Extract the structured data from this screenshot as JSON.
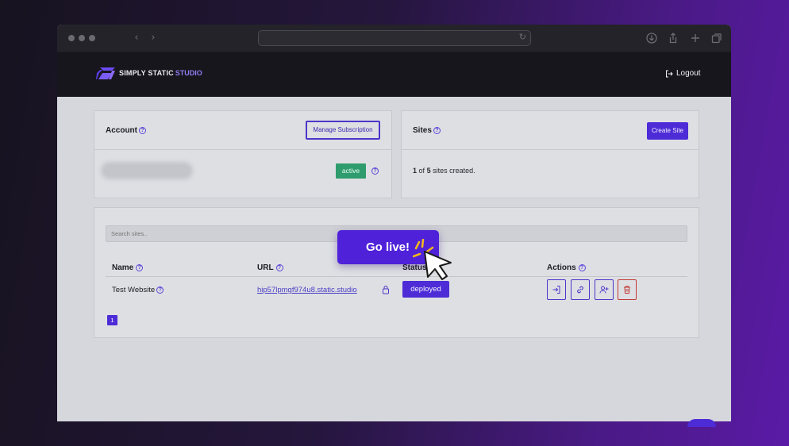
{
  "browser": {
    "url": "",
    "nav": {
      "back_icon": "chevron-left-icon",
      "forward_icon": "chevron-right-icon",
      "reload_icon": "reload-icon"
    },
    "toolbar_icons": [
      "download-icon",
      "share-icon",
      "new-tab-icon",
      "tabs-overview-icon"
    ]
  },
  "app": {
    "brand_main": "SIMPLY STATIC",
    "brand_accent": "STUDIO",
    "logout_label": "Logout"
  },
  "account": {
    "title": "Account",
    "manage_label": "Manage Subscription",
    "status": "active"
  },
  "sites_card": {
    "title": "Sites",
    "create_label": "Create Site",
    "count_used": "1",
    "count_of": "of",
    "count_total": "5",
    "count_suffix": "sites created."
  },
  "table": {
    "search_placeholder": "Search sites..",
    "headers": {
      "name": "Name",
      "url": "URL",
      "status": "Status",
      "actions": "Actions"
    },
    "rows": [
      {
        "name": "Test Website",
        "url": "hip57lpmgf974u8.static.studio",
        "status": "deployed"
      }
    ],
    "page": "1"
  },
  "overlay": {
    "cta": "Go live!"
  },
  "colors": {
    "accent": "#4d2bd6",
    "success": "#2e9c6c",
    "danger": "#c23a36",
    "appbar": "#17161d"
  }
}
